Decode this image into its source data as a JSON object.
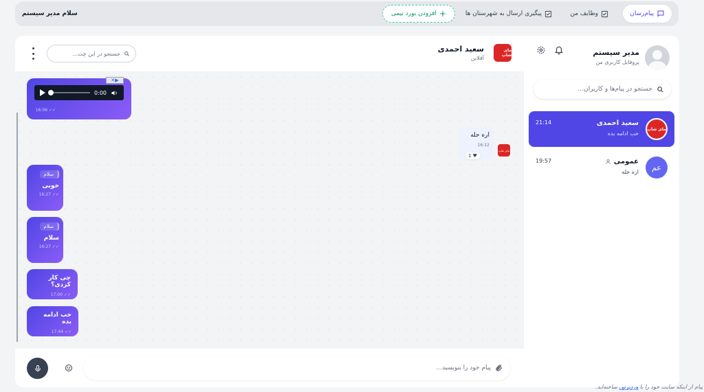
{
  "topbar": {
    "nav": {
      "messenger": "پیام‌رسان",
      "my_tasks": "وظایف من",
      "tracking": "پیگیری ارسال به شهرستان ها",
      "add_board": "افزودن بورد تیمی"
    },
    "greeting": "سلام مدیر سیستم"
  },
  "sidebar": {
    "profile": {
      "name": "مدیر سیستم",
      "subtitle": "پروفایل کاربری من"
    },
    "search_placeholder": "جستجو در پیام‌ها و کاربران...",
    "conversations": [
      {
        "title": "سعید احمدی",
        "last_message": "خب ادامه بده",
        "time": "21:14",
        "avatar_label": "مای شاپ",
        "active": true
      },
      {
        "title": "عمومی",
        "last_message": "اره حله",
        "time": "19:57",
        "avatar_label": "عم",
        "active": false
      }
    ]
  },
  "chat": {
    "header": {
      "name": "سعید احمدی",
      "status": "آفلاین",
      "avatar_label": "مای شاپ"
    },
    "search_placeholder": "جستجو در این چت...",
    "messages": {
      "audio": {
        "current_time": "0:00",
        "time": "16:06"
      },
      "incoming": {
        "text": "اره حله",
        "time": "16:12",
        "reaction": "1 ♥"
      },
      "m1": {
        "reply": "سلام",
        "text": "خوبی",
        "time": "16:27"
      },
      "m2": {
        "reply": "سلام",
        "text": "سلام",
        "time": "16:27"
      },
      "m3": {
        "text": "چی کار کردی؟",
        "time": "17:00"
      },
      "m4": {
        "text": "خب ادامه بده",
        "time": "17:44"
      }
    },
    "composer_placeholder": "پیام خود را بنویسید..."
  },
  "footer": {
    "prefix": "پیام از اینکه سایت خود را با",
    "link": "وردپرس",
    "suffix": "ساخته‌اید."
  },
  "colors": {
    "accent": "#4f46e5",
    "accent_light": "#8b5cf6",
    "success": "#059669"
  }
}
